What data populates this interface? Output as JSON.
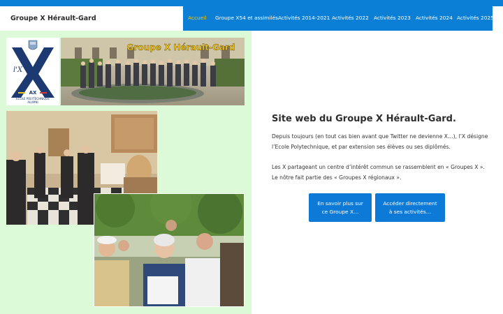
{
  "site": {
    "title": "Groupe X Hérault-Gard"
  },
  "nav": {
    "items": [
      {
        "label": "Accueil",
        "active": true
      },
      {
        "label": "Groupe X54 et assimilés"
      },
      {
        "label": "Activités 2014-2021"
      },
      {
        "label": "Activités 2022"
      },
      {
        "label": "Activités 2023"
      },
      {
        "label": "Activités 2024"
      },
      {
        "label": "Activités 2025"
      }
    ]
  },
  "logo": {
    "letter": "l'X",
    "brand": "AX",
    "line1": "ÉCOLE POLYTECHNIQUE",
    "line2": "ALUMNI"
  },
  "banner": {
    "caption": "Groupe X Hérault-Gard"
  },
  "main": {
    "headline": "Site web du Groupe X Hérault-Gard.",
    "paragraph1": "Depuis toujours (en tout cas bien avant que Twitter ne devienne X…), l’X désigne l’Ecole Polytechnique, et par extension ses élèves ou ses diplômés.",
    "paragraph2": "Les X partageant un centre d’intérêt commun se rassemblent en « Groupes X ». Le nôtre fait partie des « Groupes X régionaux ».",
    "button1": {
      "line1": "En savoir plus sur",
      "line2": "ce Groupe X…"
    },
    "button2": {
      "line1": "Accéder directement",
      "line2": "à ses activités…"
    }
  },
  "colors": {
    "nav_bg": "#0b7fd6",
    "nav_active": "#f3c614",
    "panel_bg": "#ddfad8",
    "button_bg": "#0e7ad8",
    "banner_text": "#f0c419"
  }
}
